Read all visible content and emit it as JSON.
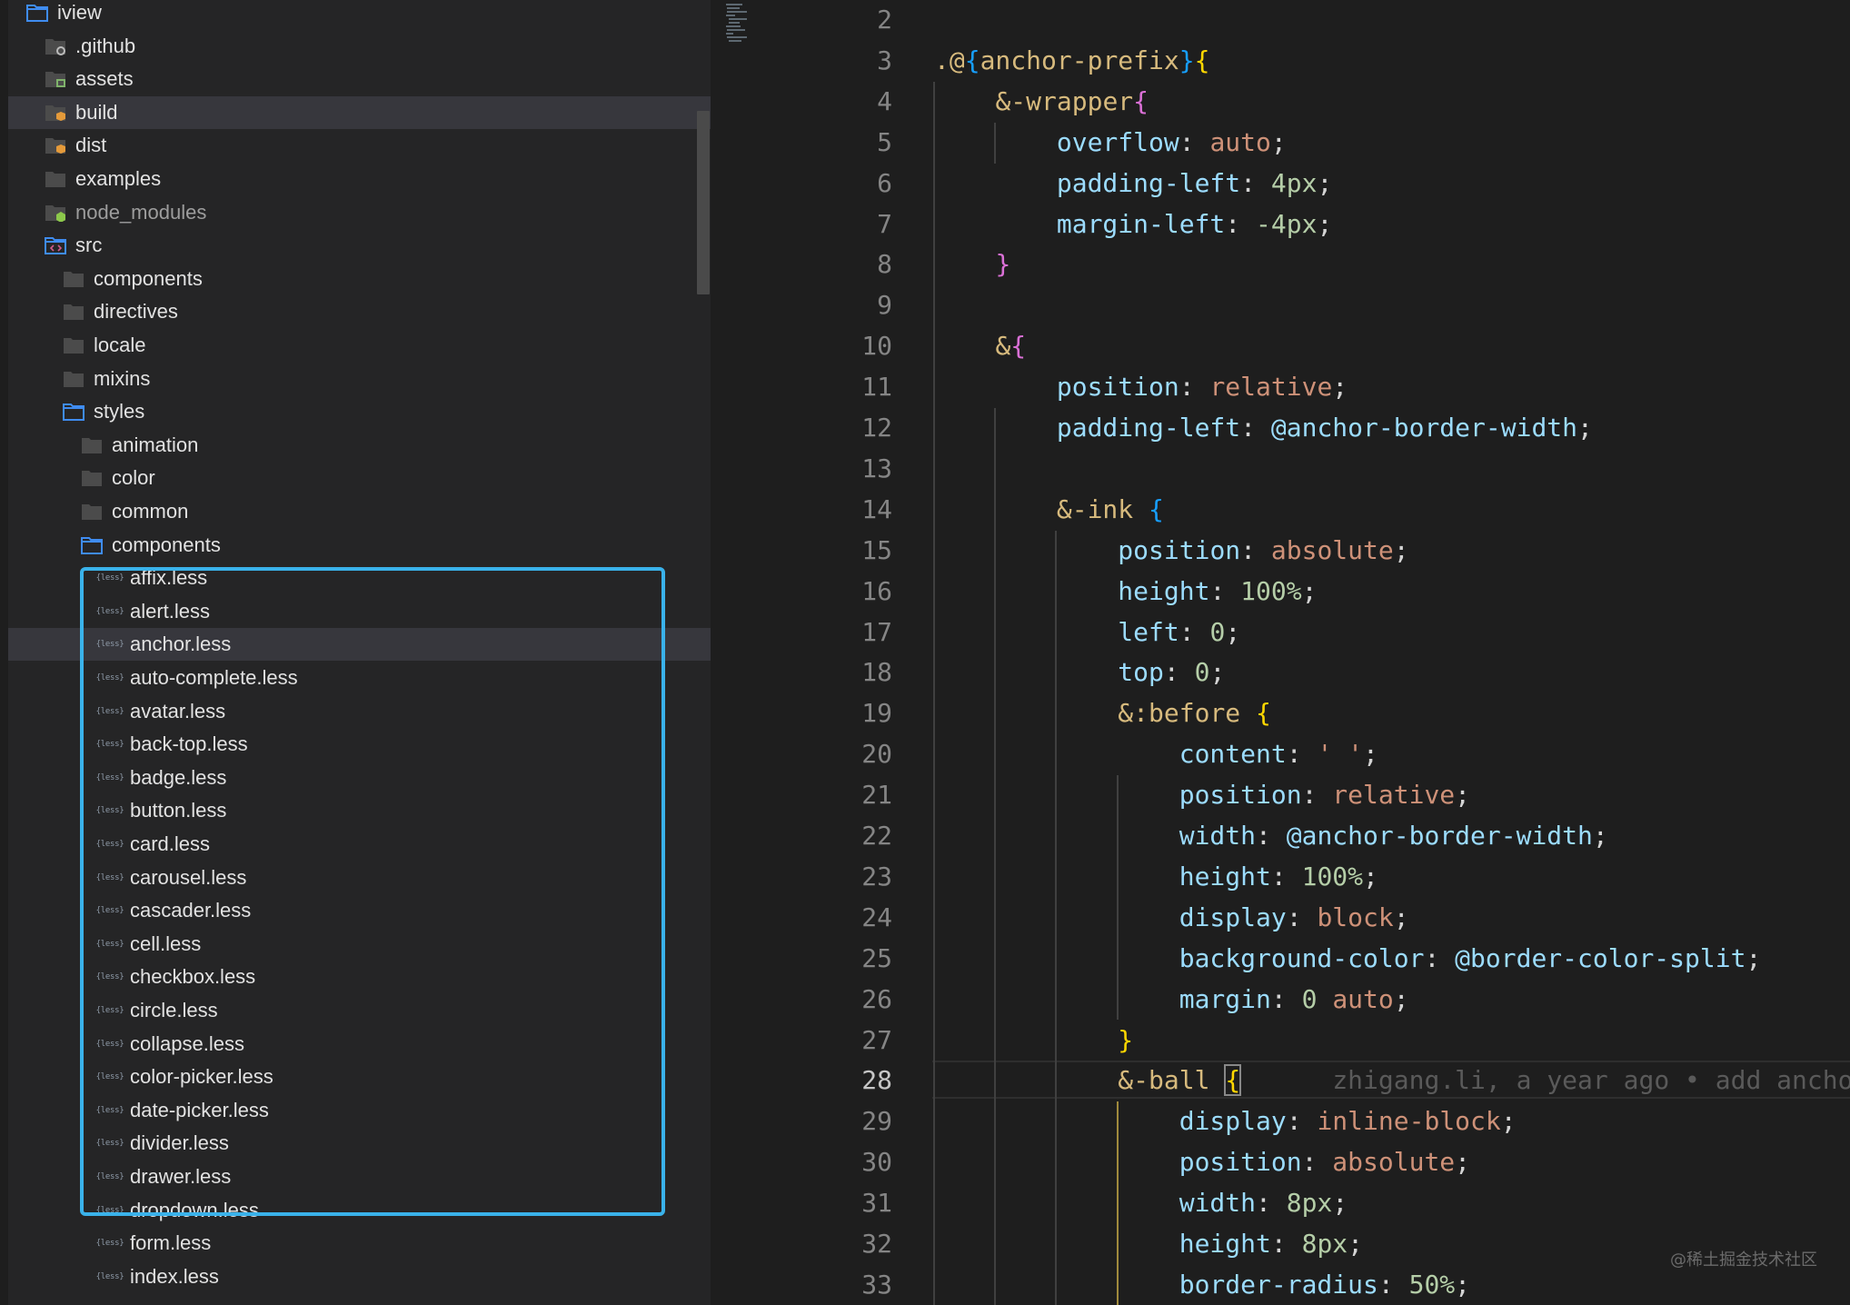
{
  "sidebar": {
    "root": "iview",
    "rows": [
      {
        "label": "iview",
        "indent": 0,
        "kind": "open-folder",
        "icon": "folder-open-icon"
      },
      {
        "label": ".github",
        "indent": 1,
        "kind": "folder",
        "icon": "github-folder-icon"
      },
      {
        "label": "assets",
        "indent": 1,
        "kind": "folder",
        "icon": "assets-folder-icon"
      },
      {
        "label": "build",
        "indent": 1,
        "kind": "folder",
        "icon": "package-folder-icon",
        "highlight": true
      },
      {
        "label": "dist",
        "indent": 1,
        "kind": "folder",
        "icon": "package-folder-icon"
      },
      {
        "label": "examples",
        "indent": 1,
        "kind": "folder",
        "icon": "folder-icon"
      },
      {
        "label": "node_modules",
        "indent": 1,
        "kind": "folder",
        "icon": "node-folder-icon",
        "dim": true
      },
      {
        "label": "src",
        "indent": 1,
        "kind": "open-folder",
        "icon": "src-folder-open-icon"
      },
      {
        "label": "components",
        "indent": 2,
        "kind": "folder",
        "icon": "folder-icon"
      },
      {
        "label": "directives",
        "indent": 2,
        "kind": "folder",
        "icon": "folder-icon"
      },
      {
        "label": "locale",
        "indent": 2,
        "kind": "folder",
        "icon": "folder-icon"
      },
      {
        "label": "mixins",
        "indent": 2,
        "kind": "folder",
        "icon": "folder-icon"
      },
      {
        "label": "styles",
        "indent": 2,
        "kind": "open-folder",
        "icon": "folder-open-icon"
      },
      {
        "label": "animation",
        "indent": 3,
        "kind": "folder",
        "icon": "folder-icon"
      },
      {
        "label": "color",
        "indent": 3,
        "kind": "folder",
        "icon": "folder-icon"
      },
      {
        "label": "common",
        "indent": 3,
        "kind": "folder",
        "icon": "folder-icon"
      },
      {
        "label": "components",
        "indent": 3,
        "kind": "open-folder",
        "icon": "folder-open-icon"
      },
      {
        "label": "affix.less",
        "indent": 4,
        "kind": "file",
        "icon": "less-file-icon"
      },
      {
        "label": "alert.less",
        "indent": 4,
        "kind": "file",
        "icon": "less-file-icon"
      },
      {
        "label": "anchor.less",
        "indent": 4,
        "kind": "file",
        "icon": "less-file-icon",
        "highlight": true
      },
      {
        "label": "auto-complete.less",
        "indent": 4,
        "kind": "file",
        "icon": "less-file-icon"
      },
      {
        "label": "avatar.less",
        "indent": 4,
        "kind": "file",
        "icon": "less-file-icon"
      },
      {
        "label": "back-top.less",
        "indent": 4,
        "kind": "file",
        "icon": "less-file-icon"
      },
      {
        "label": "badge.less",
        "indent": 4,
        "kind": "file",
        "icon": "less-file-icon"
      },
      {
        "label": "button.less",
        "indent": 4,
        "kind": "file",
        "icon": "less-file-icon"
      },
      {
        "label": "card.less",
        "indent": 4,
        "kind": "file",
        "icon": "less-file-icon"
      },
      {
        "label": "carousel.less",
        "indent": 4,
        "kind": "file",
        "icon": "less-file-icon"
      },
      {
        "label": "cascader.less",
        "indent": 4,
        "kind": "file",
        "icon": "less-file-icon"
      },
      {
        "label": "cell.less",
        "indent": 4,
        "kind": "file",
        "icon": "less-file-icon"
      },
      {
        "label": "checkbox.less",
        "indent": 4,
        "kind": "file",
        "icon": "less-file-icon"
      },
      {
        "label": "circle.less",
        "indent": 4,
        "kind": "file",
        "icon": "less-file-icon"
      },
      {
        "label": "collapse.less",
        "indent": 4,
        "kind": "file",
        "icon": "less-file-icon"
      },
      {
        "label": "color-picker.less",
        "indent": 4,
        "kind": "file",
        "icon": "less-file-icon"
      },
      {
        "label": "date-picker.less",
        "indent": 4,
        "kind": "file",
        "icon": "less-file-icon"
      },
      {
        "label": "divider.less",
        "indent": 4,
        "kind": "file",
        "icon": "less-file-icon"
      },
      {
        "label": "drawer.less",
        "indent": 4,
        "kind": "file",
        "icon": "less-file-icon"
      },
      {
        "label": "dropdown.less",
        "indent": 4,
        "kind": "file",
        "icon": "less-file-icon"
      },
      {
        "label": "form.less",
        "indent": 4,
        "kind": "file",
        "icon": "less-file-icon"
      },
      {
        "label": "index.less",
        "indent": 4,
        "kind": "file",
        "icon": "less-file-icon"
      }
    ],
    "less_icon_text": "{less}"
  },
  "editor": {
    "current_line": 28,
    "blame": "zhigang.li, a year ago • add anchor",
    "lines": [
      {
        "n": 2,
        "tokens": []
      },
      {
        "n": 3,
        "tokens": [
          [
            "sel",
            ".@"
          ],
          [
            "b3",
            "{"
          ],
          [
            "sel",
            "anchor-prefix"
          ],
          [
            "b3",
            "}"
          ],
          [
            "b1",
            "{"
          ]
        ]
      },
      {
        "n": 4,
        "tokens": [
          [
            "pun",
            "    "
          ],
          [
            "sel",
            "&-wrapper"
          ],
          [
            "b2",
            "{"
          ]
        ]
      },
      {
        "n": 5,
        "tokens": [
          [
            "pun",
            "        "
          ],
          [
            "prop",
            "overflow"
          ],
          [
            "pun",
            ": "
          ],
          [
            "val",
            "auto"
          ],
          [
            "pun",
            ";"
          ]
        ]
      },
      {
        "n": 6,
        "tokens": [
          [
            "pun",
            "        "
          ],
          [
            "prop",
            "padding-left"
          ],
          [
            "pun",
            ": "
          ],
          [
            "num",
            "4px"
          ],
          [
            "pun",
            ";"
          ]
        ]
      },
      {
        "n": 7,
        "tokens": [
          [
            "pun",
            "        "
          ],
          [
            "prop",
            "margin-left"
          ],
          [
            "pun",
            ": "
          ],
          [
            "num",
            "-4px"
          ],
          [
            "pun",
            ";"
          ]
        ]
      },
      {
        "n": 8,
        "tokens": [
          [
            "pun",
            "    "
          ],
          [
            "b2",
            "}"
          ]
        ]
      },
      {
        "n": 9,
        "tokens": []
      },
      {
        "n": 10,
        "tokens": [
          [
            "pun",
            "    "
          ],
          [
            "sel",
            "&"
          ],
          [
            "b2",
            "{"
          ]
        ]
      },
      {
        "n": 11,
        "tokens": [
          [
            "pun",
            "        "
          ],
          [
            "prop",
            "position"
          ],
          [
            "pun",
            ": "
          ],
          [
            "val",
            "relative"
          ],
          [
            "pun",
            ";"
          ]
        ]
      },
      {
        "n": 12,
        "tokens": [
          [
            "pun",
            "        "
          ],
          [
            "prop",
            "padding-left"
          ],
          [
            "pun",
            ": "
          ],
          [
            "var",
            "@anchor-border-width"
          ],
          [
            "pun",
            ";"
          ]
        ]
      },
      {
        "n": 13,
        "tokens": []
      },
      {
        "n": 14,
        "tokens": [
          [
            "pun",
            "        "
          ],
          [
            "sel",
            "&-ink "
          ],
          [
            "b3",
            "{"
          ]
        ]
      },
      {
        "n": 15,
        "tokens": [
          [
            "pun",
            "            "
          ],
          [
            "prop",
            "position"
          ],
          [
            "pun",
            ": "
          ],
          [
            "val",
            "absolute"
          ],
          [
            "pun",
            ";"
          ]
        ]
      },
      {
        "n": 16,
        "tokens": [
          [
            "pun",
            "            "
          ],
          [
            "prop",
            "height"
          ],
          [
            "pun",
            ": "
          ],
          [
            "num",
            "100%"
          ],
          [
            "pun",
            ";"
          ]
        ]
      },
      {
        "n": 17,
        "tokens": [
          [
            "pun",
            "            "
          ],
          [
            "prop",
            "left"
          ],
          [
            "pun",
            ": "
          ],
          [
            "num",
            "0"
          ],
          [
            "pun",
            ";"
          ]
        ]
      },
      {
        "n": 18,
        "tokens": [
          [
            "pun",
            "            "
          ],
          [
            "prop",
            "top"
          ],
          [
            "pun",
            ": "
          ],
          [
            "num",
            "0"
          ],
          [
            "pun",
            ";"
          ]
        ]
      },
      {
        "n": 19,
        "tokens": [
          [
            "pun",
            "            "
          ],
          [
            "sel",
            "&:before "
          ],
          [
            "b1",
            "{"
          ]
        ]
      },
      {
        "n": 20,
        "tokens": [
          [
            "pun",
            "                "
          ],
          [
            "prop",
            "content"
          ],
          [
            "pun",
            ": "
          ],
          [
            "str",
            "' '"
          ],
          [
            "pun",
            ";"
          ]
        ]
      },
      {
        "n": 21,
        "tokens": [
          [
            "pun",
            "                "
          ],
          [
            "prop",
            "position"
          ],
          [
            "pun",
            ": "
          ],
          [
            "val",
            "relative"
          ],
          [
            "pun",
            ";"
          ]
        ]
      },
      {
        "n": 22,
        "tokens": [
          [
            "pun",
            "                "
          ],
          [
            "prop",
            "width"
          ],
          [
            "pun",
            ": "
          ],
          [
            "var",
            "@anchor-border-width"
          ],
          [
            "pun",
            ";"
          ]
        ]
      },
      {
        "n": 23,
        "tokens": [
          [
            "pun",
            "                "
          ],
          [
            "prop",
            "height"
          ],
          [
            "pun",
            ": "
          ],
          [
            "num",
            "100%"
          ],
          [
            "pun",
            ";"
          ]
        ]
      },
      {
        "n": 24,
        "tokens": [
          [
            "pun",
            "                "
          ],
          [
            "prop",
            "display"
          ],
          [
            "pun",
            ": "
          ],
          [
            "val",
            "block"
          ],
          [
            "pun",
            ";"
          ]
        ]
      },
      {
        "n": 25,
        "tokens": [
          [
            "pun",
            "                "
          ],
          [
            "prop",
            "background-color"
          ],
          [
            "pun",
            ": "
          ],
          [
            "var",
            "@border-color-split"
          ],
          [
            "pun",
            ";"
          ]
        ]
      },
      {
        "n": 26,
        "tokens": [
          [
            "pun",
            "                "
          ],
          [
            "prop",
            "margin"
          ],
          [
            "pun",
            ": "
          ],
          [
            "num",
            "0 "
          ],
          [
            "val",
            "auto"
          ],
          [
            "pun",
            ";"
          ]
        ]
      },
      {
        "n": 27,
        "tokens": [
          [
            "pun",
            "            "
          ],
          [
            "b1",
            "}"
          ]
        ]
      },
      {
        "n": 28,
        "tokens": [
          [
            "pun",
            "            "
          ],
          [
            "sel",
            "&-ball "
          ],
          [
            "b1m",
            "{"
          ]
        ]
      },
      {
        "n": 29,
        "tokens": [
          [
            "pun",
            "                "
          ],
          [
            "prop",
            "display"
          ],
          [
            "pun",
            ": "
          ],
          [
            "val",
            "inline-block"
          ],
          [
            "pun",
            ";"
          ]
        ]
      },
      {
        "n": 30,
        "tokens": [
          [
            "pun",
            "                "
          ],
          [
            "prop",
            "position"
          ],
          [
            "pun",
            ": "
          ],
          [
            "val",
            "absolute"
          ],
          [
            "pun",
            ";"
          ]
        ]
      },
      {
        "n": 31,
        "tokens": [
          [
            "pun",
            "                "
          ],
          [
            "prop",
            "width"
          ],
          [
            "pun",
            ": "
          ],
          [
            "num",
            "8px"
          ],
          [
            "pun",
            ";"
          ]
        ]
      },
      {
        "n": 32,
        "tokens": [
          [
            "pun",
            "                "
          ],
          [
            "prop",
            "height"
          ],
          [
            "pun",
            ": "
          ],
          [
            "num",
            "8px"
          ],
          [
            "pun",
            ";"
          ]
        ]
      },
      {
        "n": 33,
        "tokens": [
          [
            "pun",
            "                "
          ],
          [
            "prop",
            "border-radius"
          ],
          [
            "pun",
            ": "
          ],
          [
            "num",
            "50%"
          ],
          [
            "pun",
            ";"
          ]
        ]
      }
    ]
  },
  "watermark": "@稀土掘金技术社区",
  "colors": {
    "selection_box": "#3ab2ea",
    "folder_blue": "#3f8cf0",
    "package_orange": "#e49a3a",
    "node_green": "#8cc84b"
  }
}
